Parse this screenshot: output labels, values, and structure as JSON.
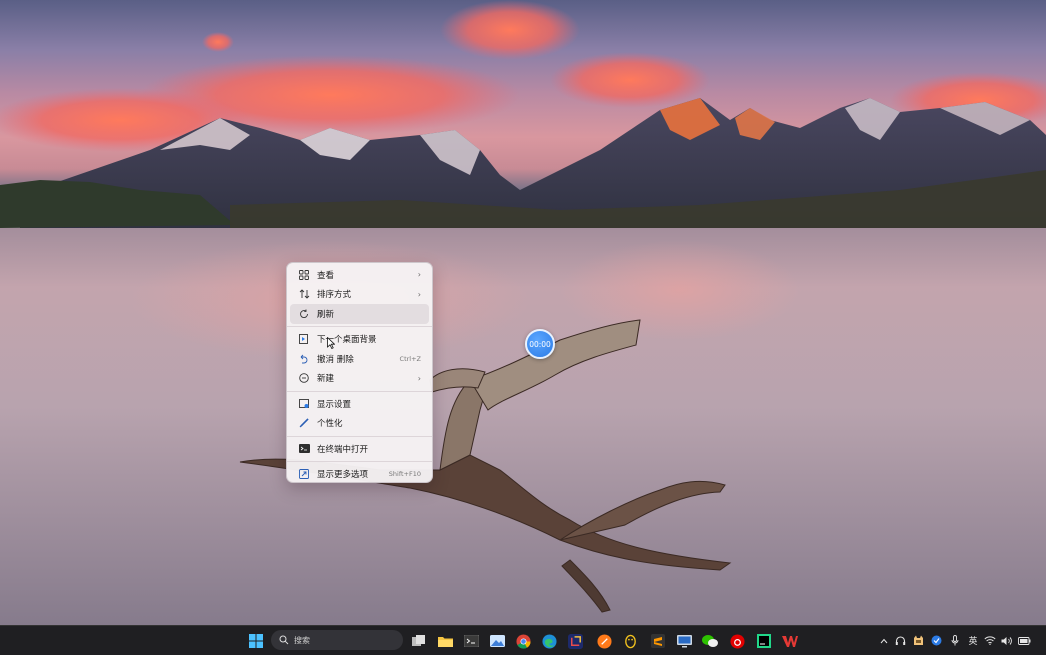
{
  "desktop": {
    "timer_badge": "00:00"
  },
  "context_menu": {
    "items": [
      {
        "label": "查看",
        "icon": "view-grid-icon",
        "submenu": true
      },
      {
        "label": "排序方式",
        "icon": "sort-arrows-icon",
        "submenu": true
      },
      {
        "label": "刷新",
        "icon": "refresh-icon",
        "hovered": true
      },
      {
        "label": "下一个桌面背景",
        "icon": "next-background-icon"
      },
      {
        "label": "撤消 删除",
        "icon": "undo-icon",
        "shortcut": "Ctrl+Z"
      },
      {
        "label": "新建",
        "icon": "new-plus-icon",
        "submenu": true
      },
      {
        "label": "显示设置",
        "icon": "display-settings-icon"
      },
      {
        "label": "个性化",
        "icon": "personalize-brush-icon"
      },
      {
        "label": "在终端中打开",
        "icon": "terminal-icon"
      },
      {
        "label": "显示更多选项",
        "icon": "more-options-icon",
        "shortcut": "Shift+F10"
      }
    ]
  },
  "taskbar": {
    "search_placeholder": "搜索",
    "pinned_apps": [
      "start-icon",
      "task-view-icon",
      "file-explorer-icon",
      "terminal-app-icon",
      "photos-icon",
      "chrome-icon",
      "edge-icon",
      "capture-app-icon",
      "orange-app-icon",
      "qq-penguin-icon",
      "sublime-icon",
      "remote-desktop-icon",
      "wechat-icon",
      "netease-music-icon",
      "pycharm-icon",
      "wps-icon"
    ],
    "tray": {
      "input_method": "英",
      "icons": [
        "chevron-up-icon",
        "headset-icon",
        "cat-app-icon",
        "shield-icon",
        "microphone-icon",
        "wifi-icon",
        "volume-icon",
        "battery-icon"
      ]
    }
  },
  "colors": {
    "taskbar": "#1f1f22",
    "menu_background": "#f6f2f4",
    "menu_hover": "#e1dade",
    "timer_badge": "#2c7be5"
  }
}
